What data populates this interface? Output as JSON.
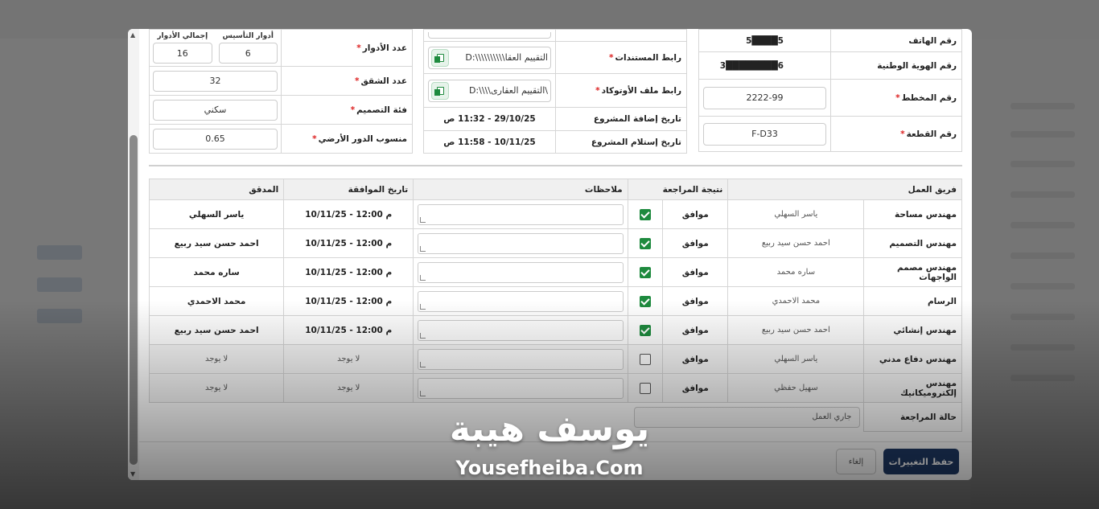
{
  "project_info": {
    "phone_label": "رقم الهاتف",
    "phone_value": "5████5",
    "national_id_label": "رقم الهوية الوطنية",
    "national_id_value": "3████████6",
    "plan_no_label": "رقم المخطط",
    "plan_no_value": "2222-99",
    "plot_no_label": "رقم القطعة",
    "plot_no_value": "F-D33"
  },
  "documents": {
    "docs_link_label": "رابط المستندات",
    "docs_link_value": "D:\\\\\\\\\\\\\\\\\\\\التقييم العقا",
    "autocad_link_label": "رابط ملف الأوتوكاد",
    "autocad_link_value": "D:\\\\\\\\التقييم العقارى\\",
    "added_date_label": "تاريخ إضافة المشروع",
    "added_date_value": "29/10/25 - 11:32 ص",
    "received_date_label": "تاريخ إستلام المشروع",
    "received_date_value": "10/11/25 - 11:58 ص"
  },
  "building": {
    "floors_label": "عدد الأدوار",
    "foundation_floors_label": "أدوار التأسيس",
    "foundation_floors_value": "6",
    "total_floors_label": "إجمالي الأدوار",
    "total_floors_value": "16",
    "apartments_label": "عدد الشقق",
    "apartments_value": "32",
    "design_class_label": "فئة التصميم",
    "design_class_value": "سكني",
    "ground_level_label": "منسوب الدور الأرضي",
    "ground_level_value": "0.65"
  },
  "review_table": {
    "headers": {
      "team": "فريق العمل",
      "result": "نتيجة المراجعة",
      "notes": "ملاحظات",
      "approval_date": "تاريخ الموافقة",
      "auditor": "المدقق"
    },
    "rows": [
      {
        "team": "مهندس مساحة",
        "member": "ياسر السهلي",
        "result": "موافق",
        "checked": true,
        "date": "10/11/25 - 12:00 م",
        "auditor": "ياسر السهلي"
      },
      {
        "team": "مهندس التصميم",
        "member": "احمد حسن سيد ربيع",
        "result": "موافق",
        "checked": true,
        "date": "10/11/25 - 12:00 م",
        "auditor": "احمد حسن سيد ربيع"
      },
      {
        "team": "مهندس مصمم الواجهات",
        "member": "ساره محمد",
        "result": "موافق",
        "checked": true,
        "date": "10/11/25 - 12:00 م",
        "auditor": "ساره محمد"
      },
      {
        "team": "الرسام",
        "member": "محمد الاحمدي",
        "result": "موافق",
        "checked": true,
        "date": "10/11/25 - 12:00 م",
        "auditor": "محمد الاحمدي"
      },
      {
        "team": "مهندس إنشائي",
        "member": "احمد حسن سيد ربيع",
        "result": "موافق",
        "checked": true,
        "date": "10/11/25 - 12:00 م",
        "auditor": "احمد حسن سيد ربيع"
      },
      {
        "team": "مهندس دفاع مدني",
        "member": "ياسر السهلي",
        "result": "موافق",
        "checked": false,
        "date": "لا يوجد",
        "auditor": "لا يوجد"
      },
      {
        "team": "مهندس إلكتروميكانيك",
        "member": "سهيل حفظي",
        "result": "موافق",
        "checked": false,
        "date": "لا يوجد",
        "auditor": "لا يوجد"
      }
    ],
    "status_label": "حالة المراجعة",
    "status_value": "جاري العمل"
  },
  "footer": {
    "save_label": "حفظ التغييرات",
    "cancel_label": "إلغاء"
  },
  "watermark": {
    "arabic": "يوسف هيبة",
    "english": "Yousefheiba.Com"
  },
  "colors": {
    "primary": "#1f3a66",
    "check_green": "#1e8a3e",
    "required_red": "#d22222"
  }
}
